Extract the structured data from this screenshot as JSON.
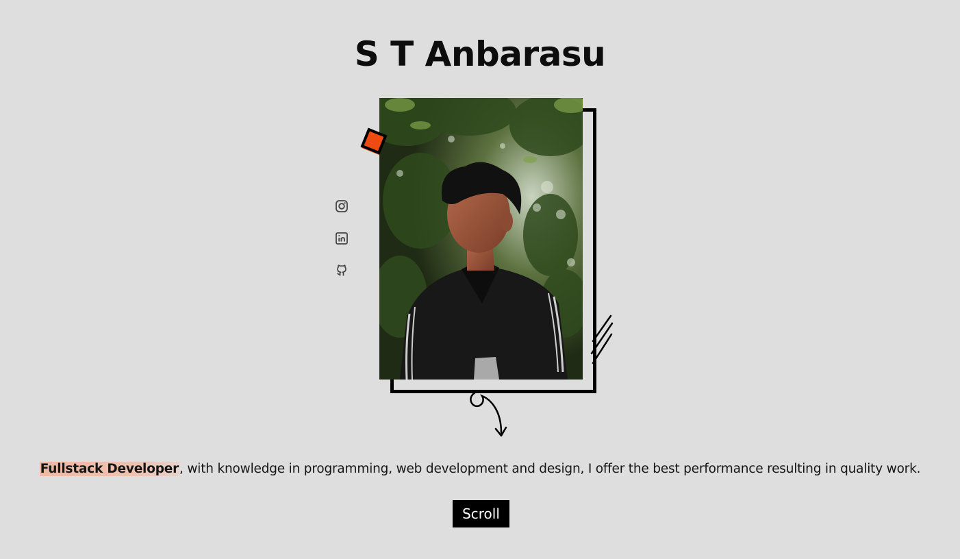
{
  "header": {
    "name": "S T Anbarasu"
  },
  "socials": [
    {
      "icon": "instagram-icon"
    },
    {
      "icon": "linkedin-icon"
    },
    {
      "icon": "github-icon"
    }
  ],
  "intro": {
    "role": "Fullstack Developer",
    "text": ", with knowledge in programming, web development and design, I offer the best performance resulting in quality work."
  },
  "actions": {
    "scroll_label": "Scroll"
  },
  "colors": {
    "background": "#dedede",
    "accent": "#ee4b12",
    "highlight": "#eebba5",
    "ink": "#000000"
  }
}
